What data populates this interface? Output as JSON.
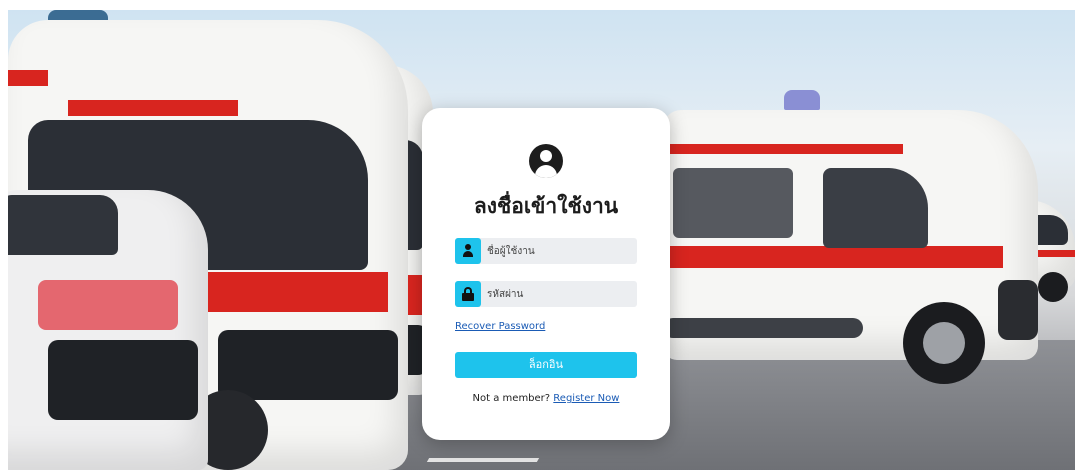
{
  "login": {
    "title": "ลงชื่อเข้าใช้งาน",
    "username_placeholder": "ชื่อผู้ใช้งาน",
    "password_placeholder": "รหัสผ่าน",
    "recover_label": "Recover Password",
    "login_button": "ล็อกอิน",
    "not_member_text": "Not a member?",
    "register_label": "Register Now"
  },
  "icons": {
    "avatar": "user-circle-icon",
    "username": "person-icon",
    "password": "lock-icon"
  },
  "colors": {
    "accent": "#1ec3ec",
    "link": "#1a5bb5",
    "card": "#ffffff",
    "ambulance_stripe": "#d8251f"
  }
}
